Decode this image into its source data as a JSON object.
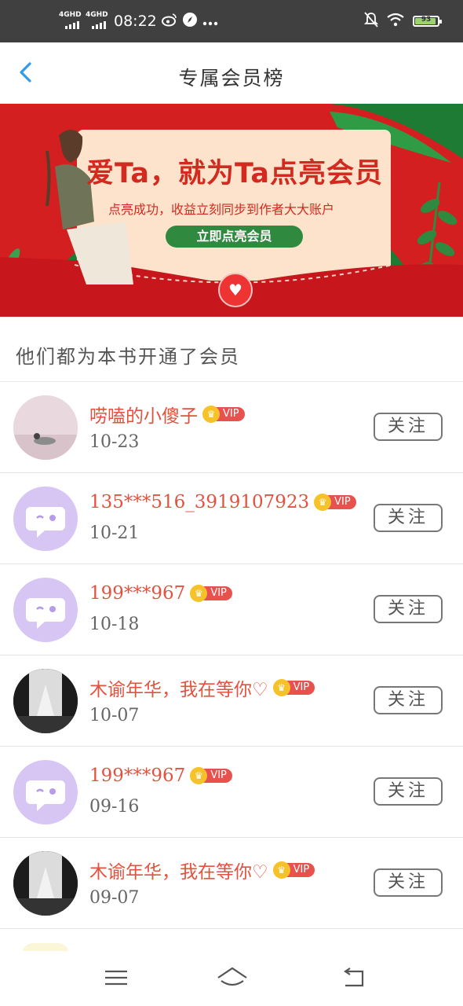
{
  "status_bar": {
    "signal1": "4GHD",
    "signal2": "4GHD",
    "time": "08:22",
    "battery": "93",
    "icons": [
      "weibo-icon",
      "compass-icon",
      "more-icon",
      "mute-icon",
      "wifi-icon"
    ]
  },
  "header": {
    "title": "专属会员榜"
  },
  "banner": {
    "headline": "爱Ta，就为Ta点亮会员",
    "subline": "点亮成功，收益立刻同步到作者大大账户",
    "button": "立即点亮会员"
  },
  "section": {
    "title": "他们都为本书开通了会员"
  },
  "members": [
    {
      "name": "唠嗑的小傻子",
      "date": "10-23",
      "vip": "VIP",
      "follow": "关注",
      "avatar": "photo-pink"
    },
    {
      "name": "135***516_3919107923",
      "date": "10-21",
      "vip": "VIP",
      "follow": "关注",
      "avatar": "default-purple"
    },
    {
      "name": "199***967",
      "date": "10-18",
      "vip": "VIP",
      "follow": "关注",
      "avatar": "default-purple"
    },
    {
      "name": "木谕年华，我在等你♡",
      "date": "10-07",
      "vip": "VIP",
      "follow": "关注",
      "avatar": "photo-bw"
    },
    {
      "name": "199***967",
      "date": "09-16",
      "vip": "VIP",
      "follow": "关注",
      "avatar": "default-purple"
    },
    {
      "name": "木谕年华，我在等你♡",
      "date": "09-07",
      "vip": "VIP",
      "follow": "关注",
      "avatar": "photo-bw"
    }
  ],
  "colors": {
    "accent_red": "#e2523e",
    "banner_red": "#d31f1f",
    "banner_green": "#2f8a3f",
    "back_blue": "#2f9bea",
    "default_avatar": "#d7c6f4"
  }
}
